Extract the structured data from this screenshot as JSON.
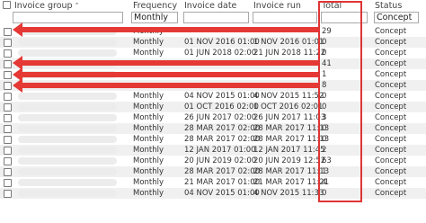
{
  "columns": {
    "invoice_group": "Invoice group",
    "frequency": "Frequency",
    "invoice_date": "Invoice date",
    "invoice_run": "Invoice run",
    "total": "Total",
    "status": "Status"
  },
  "filters": {
    "frequency_value": "Monthly",
    "status_value": "Concept"
  },
  "rows": [
    {
      "frequency": "Monthly",
      "invoice_date": "",
      "invoice_run": "",
      "total": "29",
      "status": "Concept"
    },
    {
      "frequency": "Monthly",
      "invoice_date": "01 NOV 2016 01:00",
      "invoice_run": "1 NOV 2016 01:01",
      "total": "0",
      "status": "Concept"
    },
    {
      "frequency": "Monthly",
      "invoice_date": "01 JUN 2018 02:00",
      "invoice_run": "21 JUN 2018 11:22",
      "total": "0",
      "status": "Concept"
    },
    {
      "frequency": "",
      "invoice_date": "",
      "invoice_run": "",
      "total": "41",
      "status": "Concept"
    },
    {
      "frequency": "",
      "invoice_date": "",
      "invoice_run": "",
      "total": "1",
      "status": "Concept"
    },
    {
      "frequency": "",
      "invoice_date": "",
      "invoice_run": "",
      "total": "8",
      "status": "Concept"
    },
    {
      "frequency": "Monthly",
      "invoice_date": "04 NOV 2015 01:00",
      "invoice_run": "4 NOV 2015 11:52",
      "total": "0",
      "status": "Concept"
    },
    {
      "frequency": "Monthly",
      "invoice_date": "01 OCT 2016 02:00",
      "invoice_run": "1 OCT 2016 02:01",
      "total": "0",
      "status": "Concept"
    },
    {
      "frequency": "Monthly",
      "invoice_date": "26 JUN 2017 02:00",
      "invoice_run": "26 JUN 2017 11:03",
      "total": "3",
      "status": "Concept"
    },
    {
      "frequency": "Monthly",
      "invoice_date": "28 MAR 2017 02:00",
      "invoice_run": "28 MAR 2017 11:13",
      "total": "0",
      "status": "Concept"
    },
    {
      "frequency": "Monthly",
      "invoice_date": "28 MAR 2017 02:00",
      "invoice_run": "28 MAR 2017 11:13",
      "total": "0",
      "status": "Concept"
    },
    {
      "frequency": "Monthly",
      "invoice_date": "12 JAN 2017 01:00",
      "invoice_run": "12 JAN 2017 11:45",
      "total": "2",
      "status": "Concept"
    },
    {
      "frequency": "Monthly",
      "invoice_date": "20 JUN 2019 02:00",
      "invoice_run": "20 JUN 2019 12:52",
      "total": "63",
      "status": "Concept"
    },
    {
      "frequency": "Monthly",
      "invoice_date": "28 MAR 2017 02:00",
      "invoice_run": "28 MAR 2017 11:13",
      "total": "1",
      "status": "Concept"
    },
    {
      "frequency": "Monthly",
      "invoice_date": "21 MAR 2017 01:00",
      "invoice_run": "21 MAR 2017 11:21",
      "total": "4",
      "status": "Concept"
    },
    {
      "frequency": "Monthly",
      "invoice_date": "04 NOV 2015 01:00",
      "invoice_run": "4 NOV 2015 11:33",
      "total": "0",
      "status": "Concept"
    }
  ],
  "colors": {
    "highlight_border": "#e03535",
    "arrow": "#e53935",
    "alt_row": "#f0f0f0"
  }
}
